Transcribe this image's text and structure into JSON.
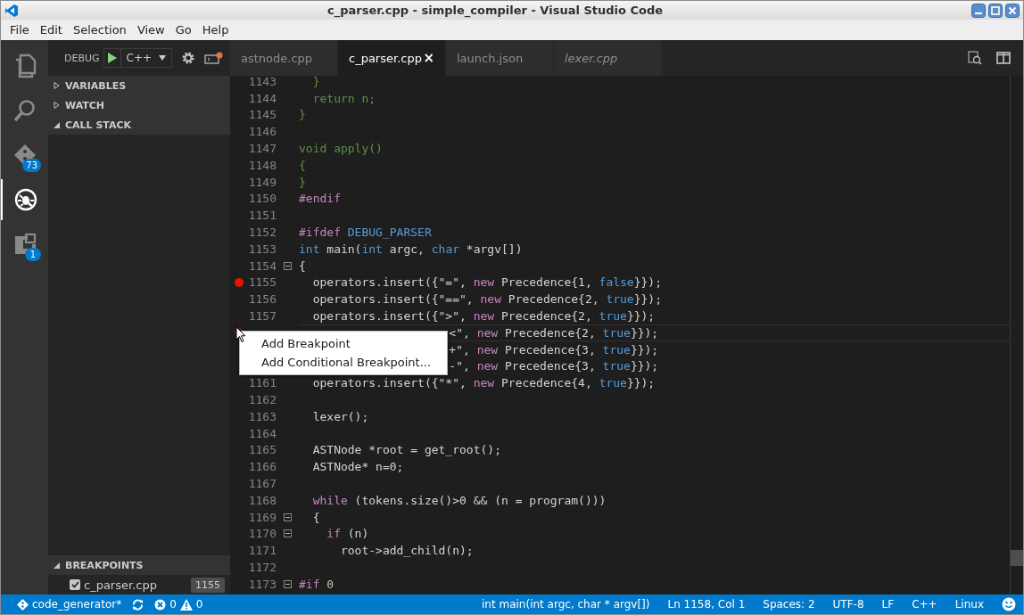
{
  "window": {
    "title": "c_parser.cpp - simple_compiler - Visual Studio Code"
  },
  "menu": [
    "File",
    "Edit",
    "Selection",
    "View",
    "Go",
    "Help"
  ],
  "activity": [
    {
      "kind": "explorer",
      "selected": false
    },
    {
      "kind": "search",
      "selected": false
    },
    {
      "kind": "git",
      "selected": false,
      "badge": "73"
    },
    {
      "kind": "debug",
      "selected": true
    },
    {
      "kind": "extensions",
      "selected": false,
      "badge": "1"
    }
  ],
  "debug_toolbar": {
    "label": "DEBUG",
    "configuration": "C++"
  },
  "sections": [
    {
      "title": "VARIABLES",
      "expanded": false
    },
    {
      "title": "WATCH",
      "expanded": false
    },
    {
      "title": "CALL STACK",
      "expanded": true
    }
  ],
  "breakpoints": {
    "title": "BREAKPOINTS",
    "expanded": true,
    "items": [
      {
        "file": "c_parser.cpp",
        "line": "1155",
        "checked": true
      }
    ]
  },
  "tabs": [
    {
      "label": "astnode.cpp",
      "selected": false,
      "preview": false
    },
    {
      "label": "c_parser.cpp",
      "selected": true,
      "preview": false,
      "close": "×"
    },
    {
      "label": "launch.json",
      "selected": false,
      "preview": false
    },
    {
      "label": "lexer.cpp",
      "selected": false,
      "preview": true
    }
  ],
  "lines": [
    {
      "number": "1143",
      "breakpoint": false,
      "hover": false,
      "fold": false,
      "current": false,
      "covered": false,
      "code": [
        {
          "text": "  }",
          "kind": "inactive"
        }
      ]
    },
    {
      "number": "1144",
      "breakpoint": false,
      "hover": false,
      "fold": false,
      "current": false,
      "covered": false,
      "code": [
        {
          "text": "  return n;",
          "kind": "inactive"
        }
      ]
    },
    {
      "number": "1145",
      "breakpoint": false,
      "hover": false,
      "fold": false,
      "current": false,
      "covered": false,
      "code": [
        {
          "text": "}",
          "kind": "inactive"
        }
      ]
    },
    {
      "number": "1146",
      "breakpoint": false,
      "hover": false,
      "fold": false,
      "current": false,
      "covered": false
    },
    {
      "number": "1147",
      "breakpoint": false,
      "hover": false,
      "fold": false,
      "current": false,
      "covered": false,
      "code": [
        {
          "text": "void apply()",
          "kind": "inactive"
        }
      ]
    },
    {
      "number": "1148",
      "breakpoint": false,
      "hover": false,
      "fold": false,
      "current": false,
      "covered": false,
      "code": [
        {
          "text": "{",
          "kind": "inactive"
        }
      ]
    },
    {
      "number": "1149",
      "breakpoint": false,
      "hover": false,
      "fold": false,
      "current": false,
      "covered": false,
      "code": [
        {
          "text": "}",
          "kind": "inactive"
        }
      ]
    },
    {
      "number": "1150",
      "breakpoint": false,
      "hover": false,
      "fold": false,
      "current": false,
      "covered": false,
      "code": [
        {
          "text": "#endif",
          "kind": "directive"
        }
      ]
    },
    {
      "number": "1151",
      "breakpoint": false,
      "hover": false,
      "fold": false,
      "current": false,
      "covered": false
    },
    {
      "number": "1152",
      "breakpoint": false,
      "hover": false,
      "fold": false,
      "current": false,
      "covered": false,
      "code": [
        {
          "text": "#ifdef",
          "kind": "directive"
        },
        {
          "text": " DEBUG_PARSER",
          "kind": "keyword"
        }
      ]
    },
    {
      "number": "1153",
      "breakpoint": false,
      "hover": false,
      "fold": false,
      "current": false,
      "covered": false,
      "code": [
        {
          "text": "int",
          "kind": "keyword"
        },
        {
          "text": " main(",
          "kind": "plain"
        },
        {
          "text": "int",
          "kind": "keyword"
        },
        {
          "text": " argc, ",
          "kind": "plain"
        },
        {
          "text": "char",
          "kind": "keyword"
        },
        {
          "text": " *argv[])",
          "kind": "plain"
        }
      ]
    },
    {
      "number": "1154",
      "breakpoint": false,
      "hover": false,
      "fold": true,
      "current": false,
      "covered": false,
      "code": [
        {
          "text": "{",
          "kind": "plain"
        }
      ]
    },
    {
      "number": "1155",
      "breakpoint": true,
      "hover": false,
      "fold": false,
      "current": false,
      "covered": false,
      "code": [
        {
          "text": "  operators.insert({\"=\", ",
          "kind": "plain"
        },
        {
          "text": "new",
          "kind": "control"
        },
        {
          "text": " Precedence{1, ",
          "kind": "plain"
        },
        {
          "text": "false",
          "kind": "keyword"
        },
        {
          "text": "}});",
          "kind": "plain"
        }
      ]
    },
    {
      "number": "1156",
      "breakpoint": false,
      "hover": false,
      "fold": false,
      "current": false,
      "covered": false,
      "code": [
        {
          "text": "  operators.insert({\"==\", ",
          "kind": "plain"
        },
        {
          "text": "new",
          "kind": "control"
        },
        {
          "text": " Precedence{2, ",
          "kind": "plain"
        },
        {
          "text": "true",
          "kind": "keyword"
        },
        {
          "text": "}});",
          "kind": "plain"
        }
      ]
    },
    {
      "number": "1157",
      "breakpoint": false,
      "hover": false,
      "fold": false,
      "current": false,
      "covered": false,
      "code": [
        {
          "text": "  operators.insert({\">\", ",
          "kind": "plain"
        },
        {
          "text": "new",
          "kind": "control"
        },
        {
          "text": " Precedence{2, ",
          "kind": "plain"
        },
        {
          "text": "true",
          "kind": "keyword"
        },
        {
          "text": "}});",
          "kind": "plain"
        }
      ]
    },
    {
      "breakpoint": false,
      "hover": true,
      "fold": false,
      "current": true,
      "covered": true,
      "code": [
        {
          "text": "<\", ",
          "kind": "plain"
        },
        {
          "text": "new",
          "kind": "control"
        },
        {
          "text": " Precedence{2, ",
          "kind": "plain"
        },
        {
          "text": "true",
          "kind": "keyword"
        },
        {
          "text": "}});",
          "kind": "plain"
        }
      ]
    },
    {
      "breakpoint": false,
      "hover": false,
      "fold": false,
      "current": false,
      "covered": true,
      "code": [
        {
          "text": "+\", ",
          "kind": "plain"
        },
        {
          "text": "new",
          "kind": "control"
        },
        {
          "text": " Precedence{3, ",
          "kind": "plain"
        },
        {
          "text": "true",
          "kind": "keyword"
        },
        {
          "text": "}});",
          "kind": "plain"
        }
      ]
    },
    {
      "breakpoint": false,
      "hover": false,
      "fold": false,
      "current": false,
      "covered": true,
      "code": [
        {
          "text": "-\", ",
          "kind": "plain"
        },
        {
          "text": "new",
          "kind": "control"
        },
        {
          "text": " Precedence{3, ",
          "kind": "plain"
        },
        {
          "text": "true",
          "kind": "keyword"
        },
        {
          "text": "}});",
          "kind": "plain"
        }
      ]
    },
    {
      "number": "1161",
      "breakpoint": false,
      "hover": false,
      "fold": false,
      "current": false,
      "covered": false,
      "code": [
        {
          "text": "  operators.insert({\"*\", ",
          "kind": "plain"
        },
        {
          "text": "new",
          "kind": "control"
        },
        {
          "text": " Precedence{4, ",
          "kind": "plain"
        },
        {
          "text": "true",
          "kind": "keyword"
        },
        {
          "text": "}});",
          "kind": "plain"
        }
      ]
    },
    {
      "number": "1162",
      "breakpoint": false,
      "hover": false,
      "fold": false,
      "current": false,
      "covered": false
    },
    {
      "number": "1163",
      "breakpoint": false,
      "hover": false,
      "fold": false,
      "current": false,
      "covered": false,
      "code": [
        {
          "text": "  lexer();",
          "kind": "plain"
        }
      ]
    },
    {
      "number": "1164",
      "breakpoint": false,
      "hover": false,
      "fold": false,
      "current": false,
      "covered": false
    },
    {
      "number": "1165",
      "breakpoint": false,
      "hover": false,
      "fold": false,
      "current": false,
      "covered": false,
      "code": [
        {
          "text": "  ASTNode *root = get_root();",
          "kind": "plain"
        }
      ]
    },
    {
      "number": "1166",
      "breakpoint": false,
      "hover": false,
      "fold": false,
      "current": false,
      "covered": false,
      "code": [
        {
          "text": "  ASTNode* n=0;",
          "kind": "plain"
        }
      ]
    },
    {
      "number": "1167",
      "breakpoint": false,
      "hover": false,
      "fold": false,
      "current": false,
      "covered": false
    },
    {
      "number": "1168",
      "breakpoint": false,
      "hover": false,
      "fold": false,
      "current": false,
      "covered": false,
      "code": [
        {
          "text": "  while",
          "kind": "control"
        },
        {
          "text": " (tokens.size()>0 && (n = program()))",
          "kind": "plain"
        }
      ]
    },
    {
      "number": "1169",
      "breakpoint": false,
      "hover": false,
      "fold": true,
      "current": false,
      "covered": false,
      "code": [
        {
          "text": "  {",
          "kind": "plain"
        }
      ]
    },
    {
      "number": "1170",
      "breakpoint": false,
      "hover": false,
      "fold": true,
      "current": false,
      "covered": false,
      "code": [
        {
          "text": "    if",
          "kind": "control"
        },
        {
          "text": " (n)",
          "kind": "plain"
        }
      ]
    },
    {
      "number": "1171",
      "breakpoint": false,
      "hover": false,
      "fold": false,
      "current": false,
      "covered": false,
      "code": [
        {
          "text": "      root->add_child(n);",
          "kind": "plain"
        }
      ]
    },
    {
      "number": "1172",
      "breakpoint": false,
      "hover": false,
      "fold": false,
      "current": false,
      "covered": false
    },
    {
      "number": "1173",
      "breakpoint": false,
      "hover": false,
      "fold": true,
      "current": false,
      "covered": false,
      "code": [
        {
          "text": "#if",
          "kind": "control"
        },
        {
          "text": " 0",
          "kind": "number"
        }
      ]
    }
  ],
  "context_menu": [
    "Add Breakpoint",
    "Add Conditional Breakpoint..."
  ],
  "status_bar": {
    "branch": "code_generator*",
    "errors": "0",
    "warnings": "0",
    "right": [
      "int main(int argc, char * argv[])",
      "Ln 1158, Col 1",
      "Spaces: 2",
      "UTF-8",
      "LF",
      "C++",
      "Linux"
    ]
  }
}
